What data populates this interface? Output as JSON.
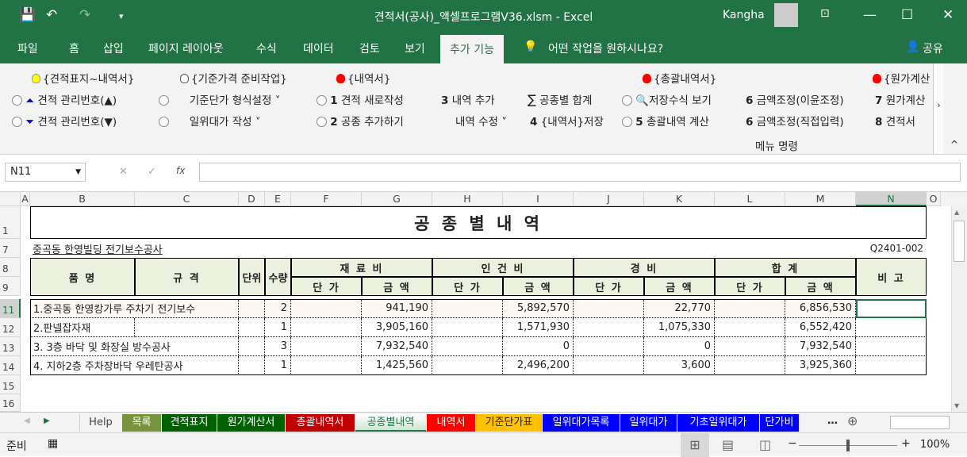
{
  "window": {
    "title": "견적서(공사)_액셀프로그램V36.xlsm  -  Excel",
    "user": "Kangha",
    "accent": "#217346"
  },
  "menu": {
    "tabs": [
      "파일",
      "홈",
      "삽입",
      "페이지 레이아웃",
      "수식",
      "데이터",
      "검토",
      "보기",
      "추가 기능"
    ],
    "active": "추가 기능",
    "tell_me": "어떤 작업을 원하시나요?",
    "share": "공유"
  },
  "ribbon": {
    "groups": [
      {
        "label": "{견적표지~내역서}",
        "bulb": "#ffff00"
      },
      {
        "label": "{기준가격 준비작업}",
        "bulb": "#ffffff"
      },
      {
        "label": "{내역서}",
        "bulb": "#ff0000"
      },
      {
        "label": "{총괄내역서}",
        "bulb": "#ff0000"
      },
      {
        "label": "{원가계산"
      }
    ],
    "row1": [
      "견적 관리번호(▲)",
      "기준단가 형식설정",
      "견적 새로작성",
      "내역 추가",
      "공종별 합계",
      "저장수식 보기",
      "금액조정(이윤조정)",
      "원가계산"
    ],
    "row2": [
      "견적 관리번호(▼)",
      "일위대가 작성",
      "공종 추가하기",
      "내역 수정",
      "{내역서}저장",
      "총괄내역 계산",
      "금액조정(직접입력)",
      "견적서"
    ],
    "nums1": [
      "1",
      "3",
      "6",
      "7"
    ],
    "nums2": [
      "2",
      "4",
      "5",
      "6",
      "8"
    ],
    "group_caption": "메뉴 명령"
  },
  "formula": {
    "name_box": "N11",
    "fx": "fx",
    "value": ""
  },
  "columns": [
    "A",
    "B",
    "C",
    "D",
    "E",
    "F",
    "G",
    "H",
    "I",
    "J",
    "K",
    "L",
    "M",
    "N",
    "O"
  ],
  "rows": [
    "1",
    "7",
    "8",
    "9",
    "11",
    "12",
    "13",
    "14",
    "15",
    "16"
  ],
  "sheet": {
    "title": "공 종 별 내 역",
    "project": "중곡동 한영빌딩 전기보수공사",
    "doc_no": "Q2401-002",
    "headers": {
      "name": "품  명",
      "spec": "규  격",
      "unit": "단위",
      "qty": "수량",
      "material": "재 료 비",
      "labor": "인 건 비",
      "expense": "경    비",
      "total": "합  계",
      "note": "비  고",
      "unit_price": "단 가",
      "amount": "금 액"
    },
    "items": [
      {
        "name": "1.중곡동 한영캉가루 주차기 전기보수",
        "qty": "2",
        "material": "941,190",
        "labor": "5,892,570",
        "expense": "22,770",
        "total": "6,856,530"
      },
      {
        "name": "2.판넬잡자재",
        "qty": "1",
        "material": "3,905,160",
        "labor": "1,571,930",
        "expense": "1,075,330",
        "total": "6,552,420"
      },
      {
        "name": "3. 3층 바닥 및 화장실 방수공사",
        "qty": "3",
        "material": "7,932,540",
        "labor": "0",
        "expense": "0",
        "total": "7,932,540"
      },
      {
        "name": "4. 지하2층 주차장바닥 우레탄공사",
        "qty": "1",
        "material": "1,425,560",
        "labor": "2,496,200",
        "expense": "3,600",
        "total": "3,925,360"
      }
    ]
  },
  "sheet_tabs": [
    {
      "label": "Help",
      "color": "#f3f3f3"
    },
    {
      "label": "목록",
      "color": "#77933c"
    },
    {
      "label": "견적표지",
      "color": "#006100"
    },
    {
      "label": "원가계산서",
      "color": "#006100"
    },
    {
      "label": "총괄내역서",
      "color": "#c00000"
    },
    {
      "label": "공종별내역",
      "color": "#ffffff",
      "active": true
    },
    {
      "label": "내역서",
      "color": "#ff0000"
    },
    {
      "label": "기준단가표",
      "color": "#ffc000"
    },
    {
      "label": "일위대가목록",
      "color": "#0000ff"
    },
    {
      "label": "일위대가",
      "color": "#0000ff"
    },
    {
      "label": "기초일위대가",
      "color": "#0000ff"
    },
    {
      "label": "단가비교",
      "color": "#0000ff"
    }
  ],
  "status": {
    "ready": "준비",
    "zoom": "100%",
    "zoom_level": 100
  }
}
